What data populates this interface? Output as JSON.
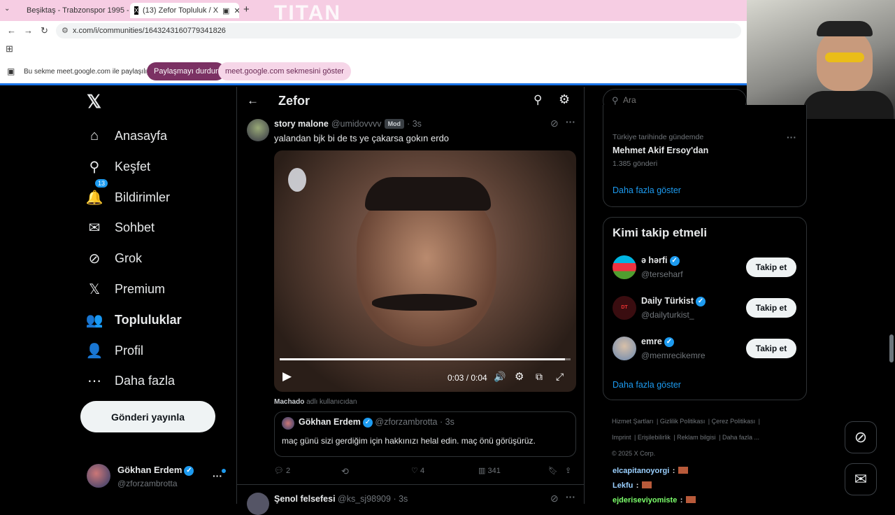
{
  "browser": {
    "tabs": [
      {
        "title": "Beşiktaş - Trabzonspor 1995 - 9",
        "color": "#e02020"
      },
      {
        "title": "(13) Zefor Topluluk / X",
        "color": "#000000"
      }
    ],
    "url": "x.com/i/communities/1643243160779341826",
    "logo_text": "TITAN",
    "share_text": "Bu sekme meet.google.com ile paylaşılıyor",
    "stop_share": "Paylaşmayı durdur",
    "share_tab": "meet.google.com sekmesini göster"
  },
  "sidebar": {
    "items": [
      {
        "label": "Anasayfa",
        "icon": "home-icon",
        "glyph": "⌂"
      },
      {
        "label": "Keşfet",
        "icon": "search-icon",
        "glyph": "⚲"
      },
      {
        "label": "Bildirimler",
        "icon": "bell-icon",
        "glyph": "🔔",
        "badge": "13"
      },
      {
        "label": "Sohbet",
        "icon": "mail-icon",
        "glyph": "✉"
      },
      {
        "label": "Grok",
        "icon": "grok-icon",
        "glyph": "⊘"
      },
      {
        "label": "Premium",
        "icon": "x-logo-icon",
        "glyph": "𝕏"
      },
      {
        "label": "Topluluklar",
        "icon": "communities-icon",
        "glyph": "👥"
      },
      {
        "label": "Profil",
        "icon": "profile-icon",
        "glyph": "👤"
      },
      {
        "label": "Daha fazla",
        "icon": "more-circle-icon",
        "glyph": "⋯"
      }
    ],
    "post_button": "Gönderi yayınla",
    "account": {
      "name": "Gökhan Erdem",
      "handle": "@zforzambrotta"
    }
  },
  "header": {
    "title": "Zefor"
  },
  "post": {
    "author": "story malone",
    "handle": "@umidovvvv",
    "badge": "Mod",
    "time": "· 3s",
    "text": "yalandan bjk bi de ts ye çakarsa gokın erdo",
    "video": {
      "time": "0:03 / 0:04",
      "progress": 0.98
    },
    "context": "Machado",
    "context_suffix": "adlı kullanıcıdan",
    "quote": {
      "author": "Gökhan Erdem",
      "handle": "@zforzambrotta",
      "time": "· 3s",
      "text": "maç günü sizi gerdiğim için hakkınızı helal edin. maç önü görüşürüz."
    },
    "stats": {
      "replies": "2",
      "likes": "4",
      "views": "341"
    }
  },
  "next_post": {
    "author": "Şenol felsefesi",
    "handle": "@ks_sj98909",
    "time": "· 3s"
  },
  "search": {
    "placeholder": "Ara"
  },
  "trend": {
    "context": "Türkiye tarihinde gündemde",
    "title": "Mehmet Akif Ersoy'dan",
    "count": "1.385 gönderi",
    "more": "Daha fazla göster"
  },
  "who_to_follow": {
    "title": "Kimi takip etmeli",
    "users": [
      {
        "name": "ə hərfi",
        "handle": "@terseharf",
        "button": "Takip et"
      },
      {
        "name": "Daily Türkist",
        "handle": "@dailyturkist_",
        "button": "Takip et"
      },
      {
        "name": "emre",
        "handle": "@memrecikemre",
        "button": "Takip et"
      }
    ],
    "more": "Daha fazla göster"
  },
  "footer": {
    "links": [
      "Hizmet Şartları",
      "Gizlilik Politikası",
      "Çerez Politikası",
      "Imprint",
      "Erişilebilirlik",
      "Reklam bilgisi",
      "Daha fazla ..."
    ],
    "copyright": "© 2025 X Corp."
  },
  "chat": [
    {
      "user": "elcapitanoyorgi",
      "sep": ":",
      "color": "#9ad0ff"
    },
    {
      "user": "Lekfu",
      "sep": ":",
      "color": "#9ad0ff"
    },
    {
      "user": "ejderiseviyomiste",
      "sep": ":",
      "color": "#7cff6b"
    }
  ]
}
